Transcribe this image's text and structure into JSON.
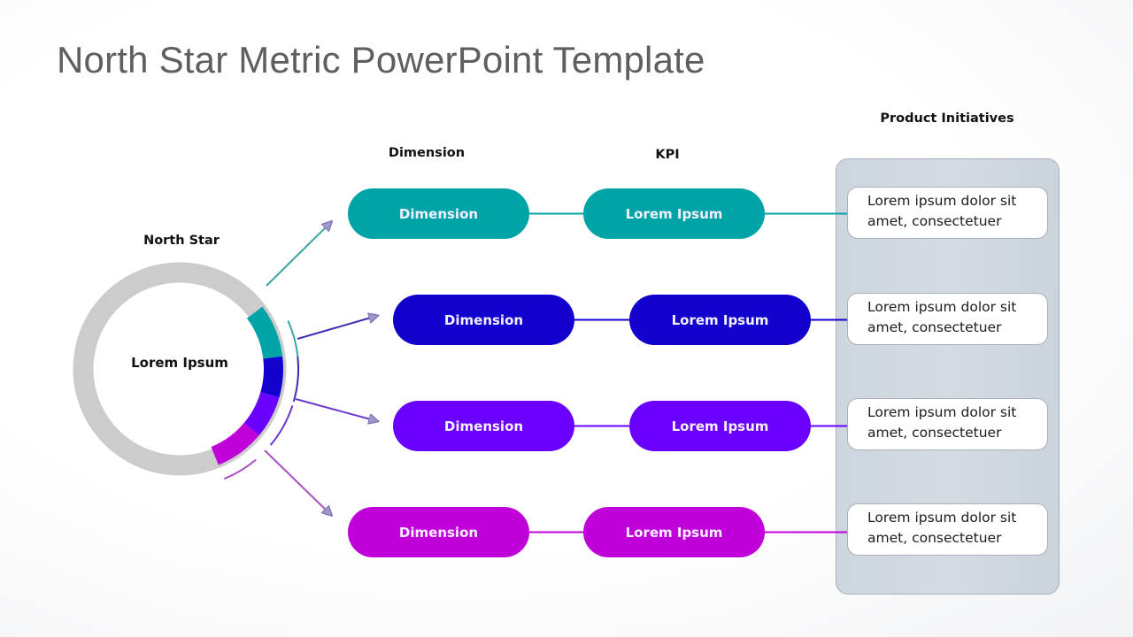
{
  "title": "North Star Metric PowerPoint Template",
  "headings": {
    "north_star": "North Star",
    "dimension": "Dimension",
    "kpi": "KPI",
    "product_initiatives": "Product Initiatives"
  },
  "north_star": {
    "center_label": "Lorem Ipsum",
    "ring_color": "#cccccc"
  },
  "rows": [
    {
      "color": "#00a3a6",
      "connector_color": "#3aa6a2",
      "dimension_label": "Dimension",
      "kpi_label": "Lorem Ipsum",
      "initiative_line1": "Lorem ipsum dolor sit",
      "initiative_line2": "amet, consectetuer"
    },
    {
      "color": "#1200cc",
      "connector_color": "#3a2bb0",
      "dimension_label": "Dimension",
      "kpi_label": "Lorem Ipsum",
      "initiative_line1": "Lorem ipsum dolor sit",
      "initiative_line2": "amet, consectetuer"
    },
    {
      "color": "#6a00ff",
      "connector_color": "#6a3ad0",
      "dimension_label": "Dimension",
      "kpi_label": "Lorem Ipsum",
      "initiative_line1": "Lorem ipsum dolor sit",
      "initiative_line2": "amet, consectetuer"
    },
    {
      "color": "#c000d8",
      "connector_color": "#a952c2",
      "dimension_label": "Dimension",
      "kpi_label": "Lorem Ipsum",
      "initiative_line1": "Lorem ipsum dolor sit",
      "initiative_line2": "amet, consectetuer"
    }
  ]
}
